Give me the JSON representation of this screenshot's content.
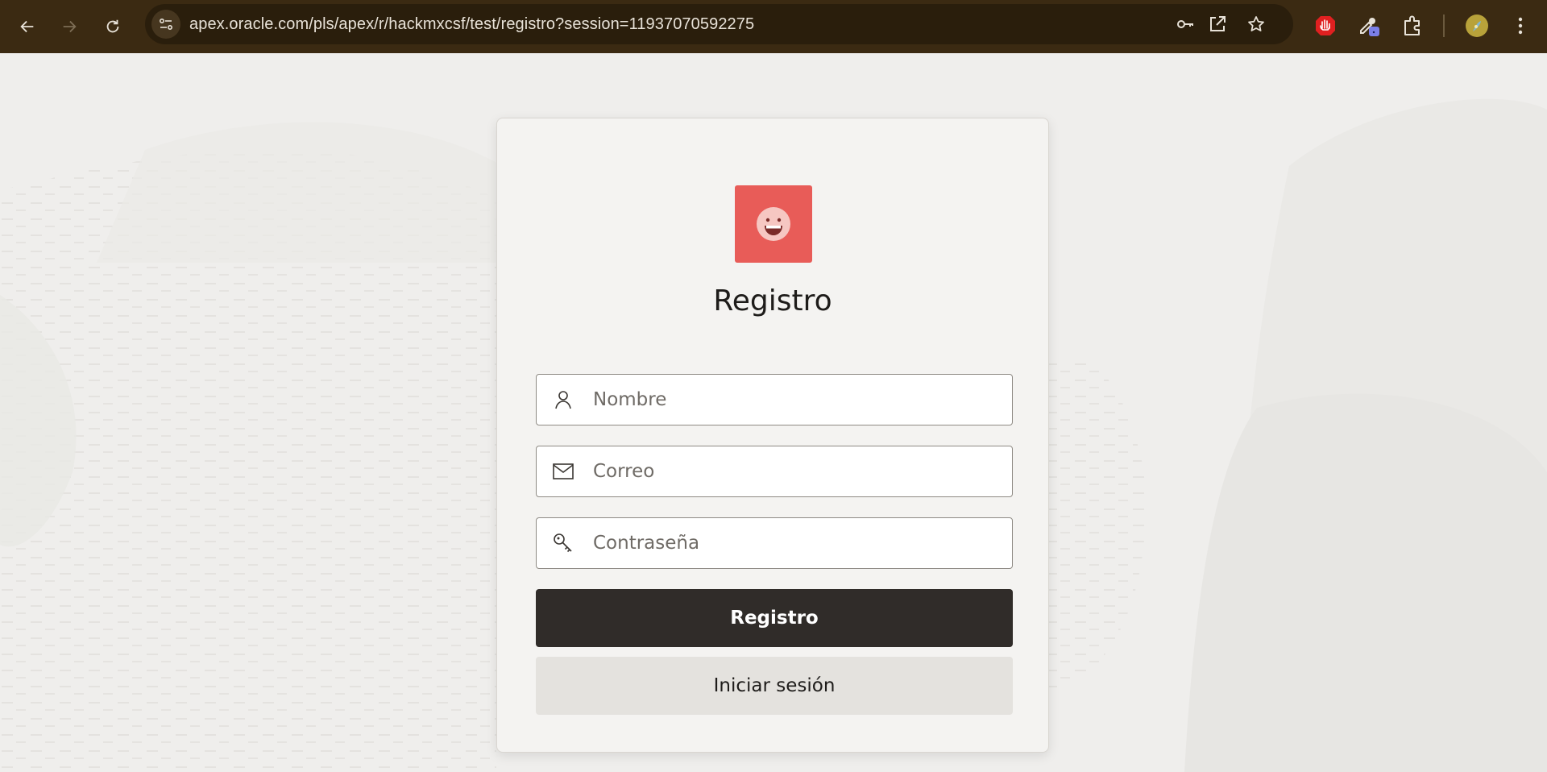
{
  "browser": {
    "url": "apex.oracle.com/pls/apex/r/hackmxcsf/test/registro?session=11937070592275",
    "icons": {
      "back": "arrow-left-icon",
      "forward": "arrow-right-icon",
      "reload": "reload-icon",
      "site_info": "tune-icon",
      "password": "key-icon",
      "open_in_app": "open-external-icon",
      "bookmark": "star-icon",
      "ext_adblock": "hand-stop-icon",
      "ext_eyedropper": "eyedropper-icon",
      "extensions": "puzzle-icon",
      "profile": "avatar",
      "menu": "kebab-menu-icon"
    }
  },
  "form": {
    "title": "Registro",
    "logo_icon": "smiley-face-icon",
    "logo_color": "#e85c58",
    "fields": [
      {
        "placeholder": "Nombre",
        "value": "",
        "icon": "user-icon"
      },
      {
        "placeholder": "Correo",
        "value": "",
        "icon": "envelope-icon"
      },
      {
        "placeholder": "Contraseña",
        "value": "",
        "icon": "key-icon"
      }
    ],
    "submit_label": "Registro",
    "login_label": "Iniciar sesión"
  },
  "colors": {
    "toolbar": "#3b2a12",
    "primary_button": "#302c29",
    "secondary_button": "#e4e2de"
  }
}
